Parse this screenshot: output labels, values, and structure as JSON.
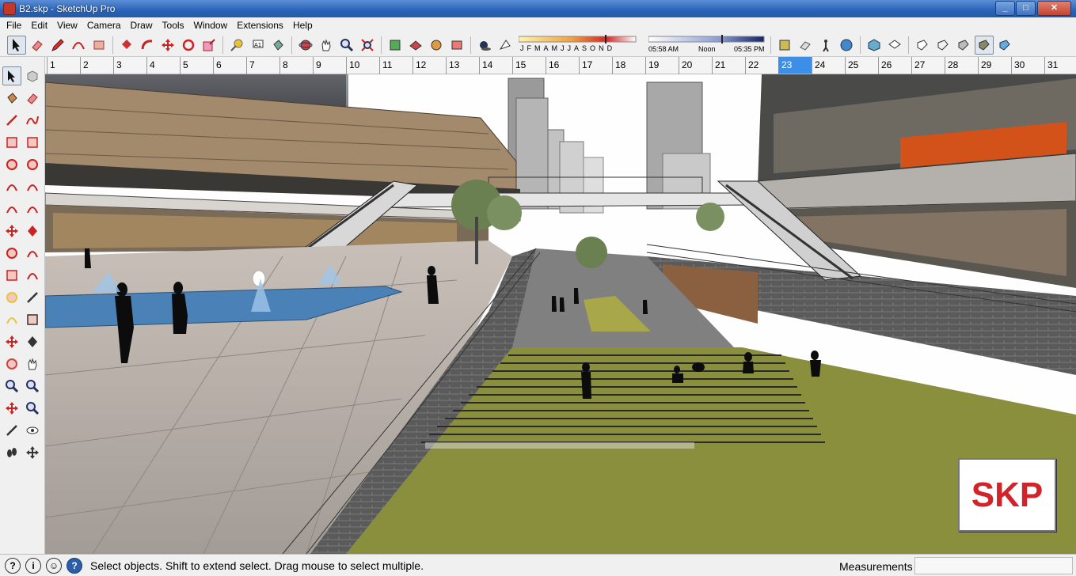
{
  "window": {
    "title": "B2.skp - SketchUp Pro",
    "minimize": "_",
    "maximize": "□",
    "close": "✕"
  },
  "menu": [
    "File",
    "Edit",
    "View",
    "Camera",
    "Draw",
    "Tools",
    "Window",
    "Extensions",
    "Help"
  ],
  "shadow": {
    "months": [
      "J",
      "F",
      "M",
      "A",
      "M",
      "J",
      "J",
      "A",
      "S",
      "O",
      "N",
      "D"
    ],
    "sunrise": "05:58 AM",
    "noon": "Noon",
    "sunset": "05:35 PM"
  },
  "ruler": {
    "numbers": [
      "1",
      "2",
      "3",
      "4",
      "5",
      "6",
      "7",
      "8",
      "9",
      "10",
      "11",
      "12",
      "13",
      "14",
      "15",
      "16",
      "17",
      "18",
      "19",
      "20",
      "21",
      "22",
      "23",
      "24",
      "25",
      "26",
      "27",
      "28",
      "29",
      "30",
      "31"
    ],
    "highlighted": "23"
  },
  "status": {
    "message": "Select objects. Shift to extend select. Drag mouse to select multiple.",
    "measurements_label": "Measurements",
    "measurements_value": ""
  },
  "watermark": "SKP",
  "colors": {
    "title_bar": "#2a63b8",
    "ground_grass": "#8a8f3e",
    "water": "#4a82b8",
    "watermark_red": "#d2232a"
  }
}
